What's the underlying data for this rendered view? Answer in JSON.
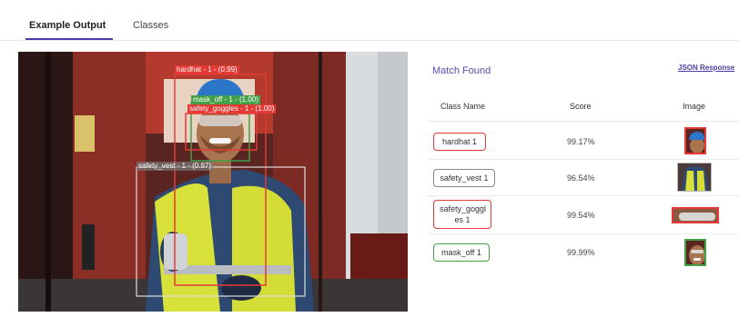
{
  "tabs": [
    {
      "label": "Example Output",
      "active": true
    },
    {
      "label": "Classes",
      "active": false
    }
  ],
  "detections": [
    {
      "label": "hardhat - 1 - (0.99)",
      "color": "#e53935"
    },
    {
      "label": "mask_off - 1 - (1.00)",
      "color": "#43a047"
    },
    {
      "label": "safety_goggles - 1 - (1.00)",
      "color": "#e53935"
    },
    {
      "label": "safety_vest - 1 - (0.97)",
      "color": "#dddddd"
    }
  ],
  "results": {
    "title": "Match Found",
    "json_link": "JSON Response",
    "columns": [
      "Class Name",
      "Score",
      "Image"
    ],
    "rows": [
      {
        "class_name": "hardhat 1",
        "score": "99.17%",
        "border": "#e53935",
        "thumb": "hardhat"
      },
      {
        "class_name": "safety_vest 1",
        "score": "96.54%",
        "border": "#888888",
        "thumb": "vest"
      },
      {
        "class_name": "safety_goggl es 1",
        "score": "99.54%",
        "border": "#e53935",
        "thumb": "goggles"
      },
      {
        "class_name": "mask_off 1",
        "score": "99.99%",
        "border": "#43a047",
        "thumb": "face"
      }
    ]
  }
}
